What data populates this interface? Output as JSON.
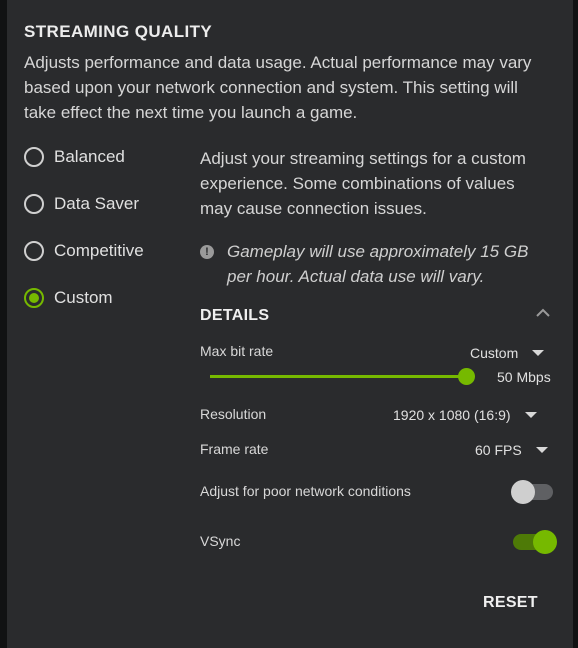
{
  "section": {
    "title": "STREAMING QUALITY",
    "description": "Adjusts performance and data usage. Actual performance may vary based upon your network connection and system. This setting will take effect the next time you launch a game."
  },
  "presets": [
    {
      "label": "Balanced",
      "selected": false
    },
    {
      "label": "Data Saver",
      "selected": false
    },
    {
      "label": "Competitive",
      "selected": false
    },
    {
      "label": "Custom",
      "selected": true
    }
  ],
  "custom": {
    "description": "Adjust your streaming settings for a custom experience. Some combinations of values may cause connection issues.",
    "info_icon": "exclamation-circle-icon",
    "info_text": "Gameplay will use approximately 15 GB per hour. Actual data use will vary."
  },
  "details": {
    "title": "DETAILS",
    "collapse_icon": "chevron-up-icon",
    "max_bit_rate": {
      "label": "Max bit rate",
      "mode": "Custom",
      "value": "50 Mbps",
      "slider_fraction": 1.0
    },
    "resolution": {
      "label": "Resolution",
      "value": "1920 x 1080 (16:9)"
    },
    "frame_rate": {
      "label": "Frame rate",
      "value": "60 FPS"
    },
    "poor_network": {
      "label": "Adjust for poor network conditions",
      "enabled": false
    },
    "vsync": {
      "label": "VSync",
      "enabled": true
    }
  },
  "reset_label": "RESET",
  "colors": {
    "accent": "#76b900",
    "panel": "#2a2b2d",
    "background": "#111213"
  }
}
